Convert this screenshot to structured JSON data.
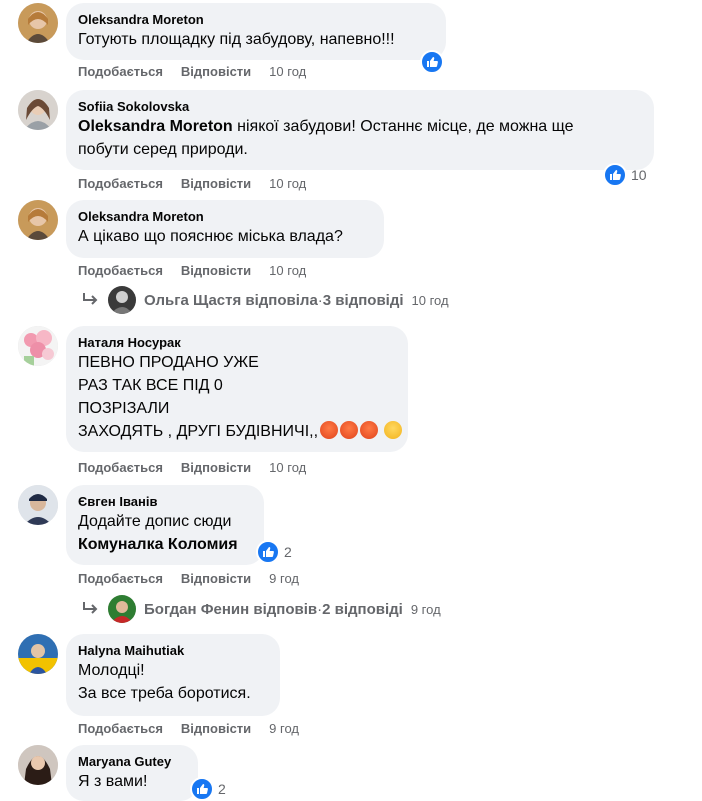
{
  "labels": {
    "like": "Подобається",
    "reply": "Відповісти"
  },
  "comments": [
    {
      "author": "Oleksandra Moreton",
      "lines": [
        "Готують площадку під забудову, напевно!!!"
      ],
      "time": "10 год"
    },
    {
      "author": "Sofiia Sokolovska",
      "mention": "Oleksandra Moreton",
      "line1_rest": " ніякої забудови! Останнє місце, де можна ще",
      "line2": "побути серед природи.",
      "reactions": "10",
      "time": "10 год"
    },
    {
      "author": "Oleksandra Moreton",
      "lines": [
        "А цікаво що пояснює міська влада?"
      ],
      "time": "10 год",
      "replies": {
        "who": "Ольга Щастя відповіла",
        "sep": " · ",
        "count": "3 відповіді",
        "time": "10 год"
      }
    },
    {
      "author": "Наталя Носурак",
      "lines": [
        "ПЕВНО ПРОДАНО УЖЕ",
        "РАЗ ТАК ВСЕ ПІД 0",
        "ПОЗРІЗАЛИ",
        "ЗАХОДЯТЬ , ДРУГІ БУДІВНИЧІ,,"
      ],
      "time": "10 год"
    },
    {
      "author": "Євген Іванів",
      "lines": [
        "Додайте допис сюди"
      ],
      "mention": "Комуналка Коломия",
      "reactions": "2",
      "time": "9 год",
      "replies": {
        "who": "Богдан Фенин відповів",
        "sep": " · ",
        "count": "2 відповіді",
        "time": "9 год"
      }
    },
    {
      "author": "Halyna Maihutiak",
      "lines": [
        "Молодці!",
        "За все треба боротися."
      ],
      "time": "9 год"
    },
    {
      "author": "Maryana Gutey",
      "lines": [
        "Я з вами!"
      ],
      "reactions": "2"
    }
  ],
  "colors": {
    "like_blue": "#1877f2",
    "bubble": "#f0f2f5",
    "meta": "#65676b"
  },
  "icons": {
    "like": "thumbs-up-icon",
    "reply_arrow": "reply-arrow-icon",
    "angry": "angry-emoji",
    "sad": "sad-emoji"
  }
}
